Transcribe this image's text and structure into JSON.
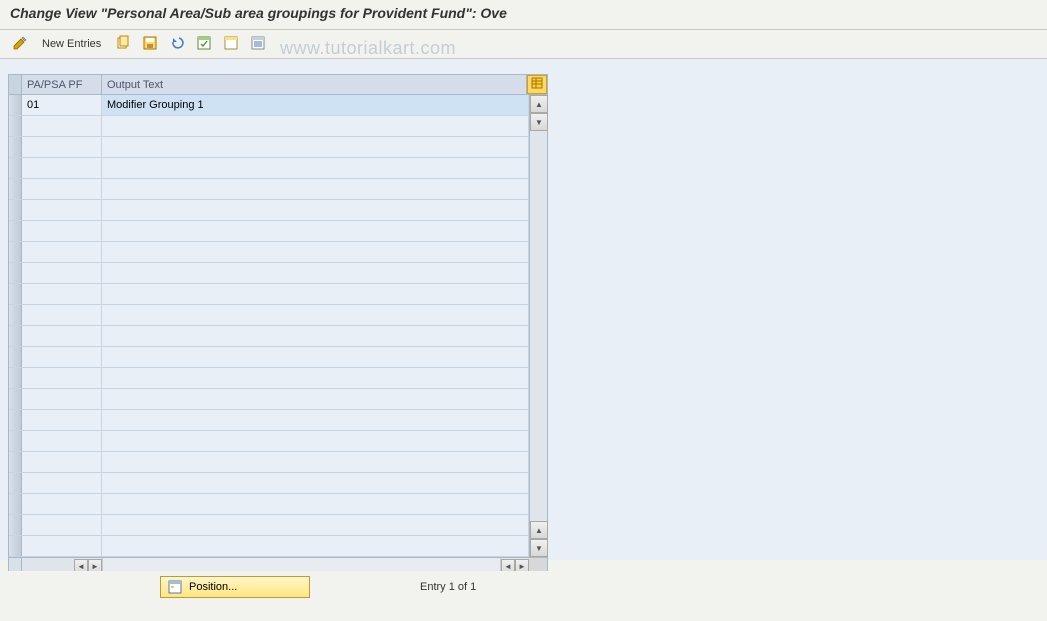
{
  "header": {
    "title": "Change View \"Personal Area/Sub area groupings for Provident Fund\": Ove"
  },
  "toolbar": {
    "new_entries_label": "New Entries"
  },
  "table": {
    "columns": {
      "col1": "PA/PSA PF",
      "col2": "Output Text"
    },
    "rows": [
      {
        "c1": "01",
        "c2": "Modifier Grouping 1"
      },
      {
        "c1": "",
        "c2": ""
      },
      {
        "c1": "",
        "c2": ""
      },
      {
        "c1": "",
        "c2": ""
      },
      {
        "c1": "",
        "c2": ""
      },
      {
        "c1": "",
        "c2": ""
      },
      {
        "c1": "",
        "c2": ""
      },
      {
        "c1": "",
        "c2": ""
      },
      {
        "c1": "",
        "c2": ""
      },
      {
        "c1": "",
        "c2": ""
      },
      {
        "c1": "",
        "c2": ""
      },
      {
        "c1": "",
        "c2": ""
      },
      {
        "c1": "",
        "c2": ""
      },
      {
        "c1": "",
        "c2": ""
      },
      {
        "c1": "",
        "c2": ""
      },
      {
        "c1": "",
        "c2": ""
      },
      {
        "c1": "",
        "c2": ""
      },
      {
        "c1": "",
        "c2": ""
      },
      {
        "c1": "",
        "c2": ""
      },
      {
        "c1": "",
        "c2": ""
      },
      {
        "c1": "",
        "c2": ""
      },
      {
        "c1": "",
        "c2": ""
      }
    ]
  },
  "footer": {
    "position_label": "Position...",
    "entry_text": "Entry 1 of 1"
  },
  "watermark": "www.tutorialkart.com"
}
